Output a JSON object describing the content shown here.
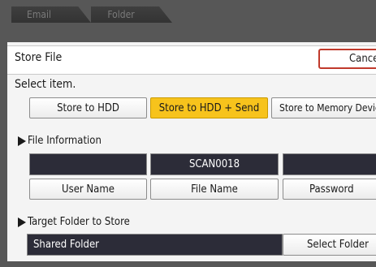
{
  "tabs": [
    {
      "label": "Email"
    },
    {
      "label": "Folder"
    }
  ],
  "header": {
    "title": "Store File",
    "cancel_label": "Cancel"
  },
  "prompt": "Select item.",
  "store_options": [
    {
      "label": "Store to HDD",
      "selected": false
    },
    {
      "label": "Store to HDD + Send",
      "selected": true
    },
    {
      "label": "Store to Memory Device",
      "selected": false
    }
  ],
  "file_info": {
    "section_label": "File Information",
    "user_name_value": "",
    "file_name_value": "SCAN0018",
    "password_value": "",
    "user_name_button": "User Name",
    "file_name_button": "File Name",
    "password_button": "Password"
  },
  "target": {
    "section_label": "Target Folder to Store",
    "folder_value": "Shared Folder",
    "select_button": "Select Folder"
  },
  "colors": {
    "selected_accent": "#f7c31c",
    "cancel_border": "#c0392b",
    "field_background": "#2c2c38",
    "frame": "#575757"
  }
}
